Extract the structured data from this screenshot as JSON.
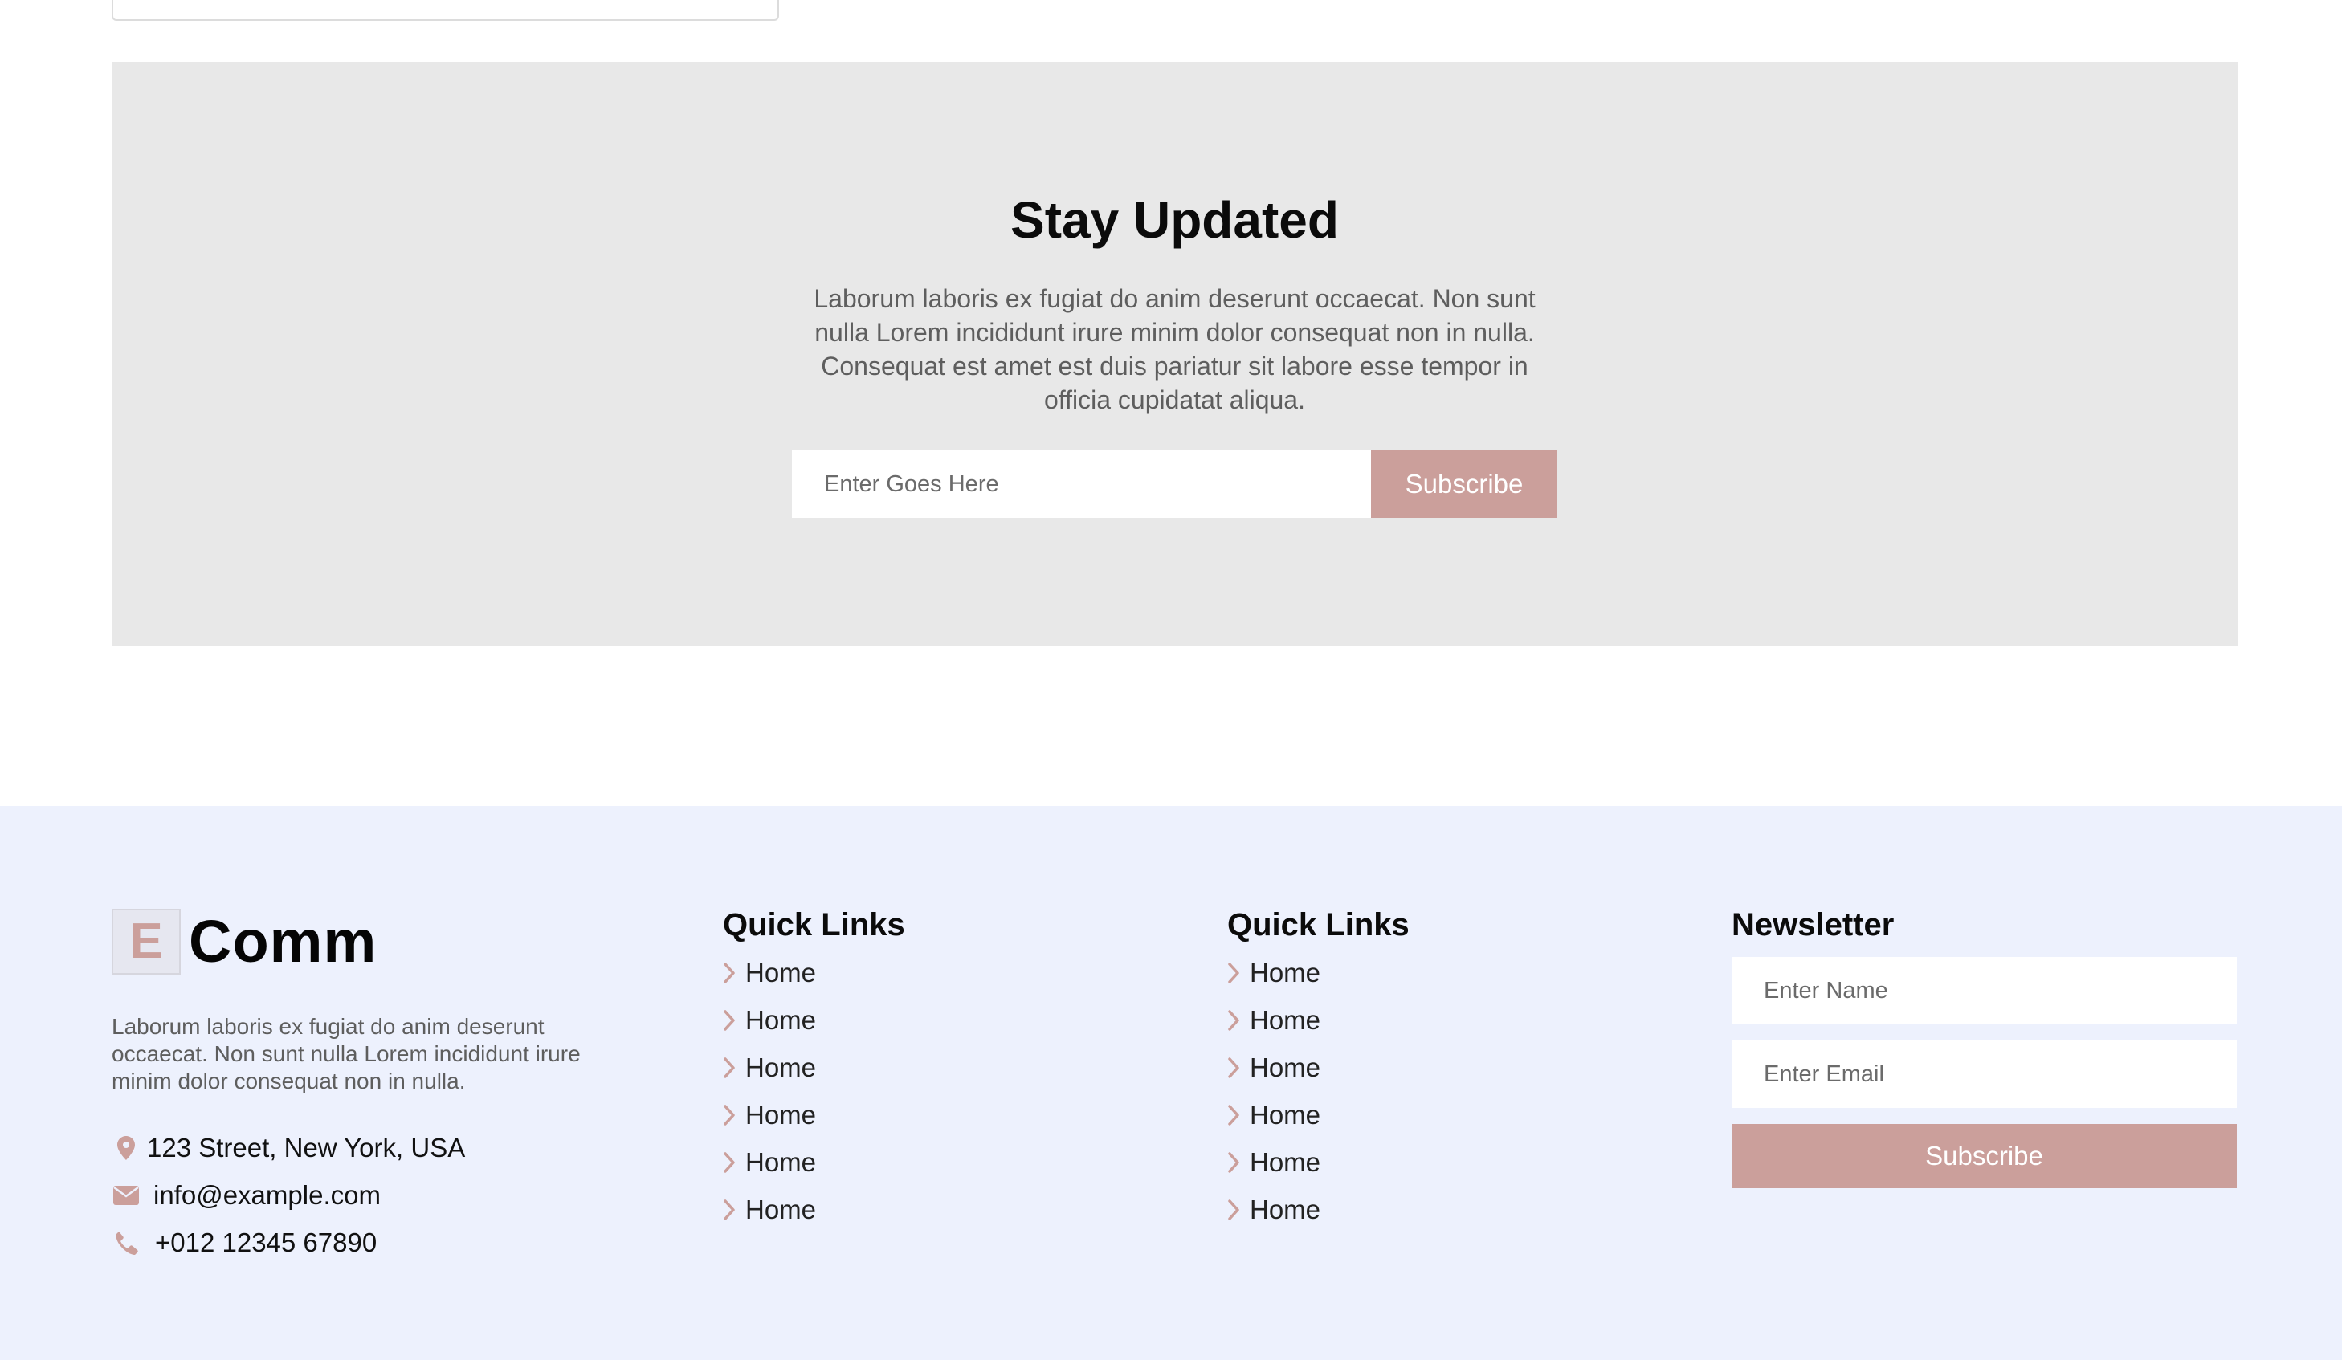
{
  "colors": {
    "accent": "#cb9f9b",
    "section_bg": "#e8e8e8",
    "footer_bg": "#edf1fd"
  },
  "stay_updated": {
    "title": "Stay Updated",
    "description": "Laborum laboris ex fugiat do anim deserunt occaecat. Non sunt nulla Lorem incididunt irure minim dolor consequat non in nulla. Consequat est amet est duis pariatur sit labore esse tempor in officia cupidatat aliqua.",
    "input_placeholder": "Enter Goes Here",
    "button_label": "Subscribe"
  },
  "footer": {
    "logo": {
      "mark": "E",
      "text": "Comm"
    },
    "about": "Laborum laboris ex fugiat do anim deserunt occaecat. Non sunt nulla Lorem incididunt irure minim dolor consequat non in nulla.",
    "contact": {
      "address": "123 Street, New York, USA",
      "email": "info@example.com",
      "phone": "+012 12345 67890"
    },
    "quick_links_1": {
      "title": "Quick Links",
      "items": [
        "Home",
        "Home",
        "Home",
        "Home",
        "Home",
        "Home"
      ]
    },
    "quick_links_2": {
      "title": "Quick Links",
      "items": [
        "Home",
        "Home",
        "Home",
        "Home",
        "Home",
        "Home"
      ]
    },
    "newsletter": {
      "title": "Newsletter",
      "name_placeholder": "Enter Name",
      "email_placeholder": "Enter Email",
      "button_label": "Subscribe"
    },
    "icons": [
      "map-marker-icon",
      "envelope-icon",
      "phone-icon",
      "chevron-right-icon"
    ]
  }
}
